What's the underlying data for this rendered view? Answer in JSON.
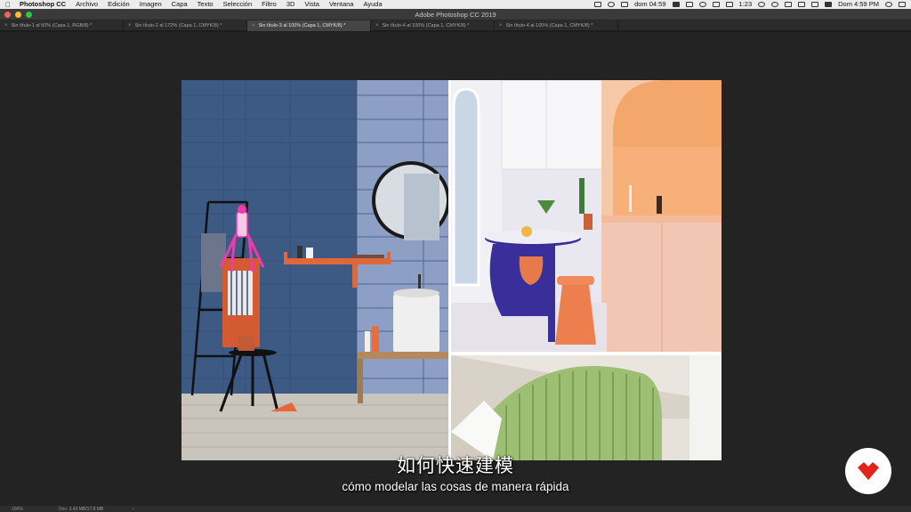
{
  "menubar": {
    "app_name": "Photoshop CC",
    "items": [
      "Archivo",
      "Edición",
      "Imagen",
      "Capa",
      "Texto",
      "Selección",
      "Filtro",
      "3D",
      "Vista",
      "Ventana",
      "Ayuda"
    ],
    "status_time_left": "dom 04:59",
    "battery": "1:23",
    "clock": "Dom 4:59 PM"
  },
  "window": {
    "title": "Adobe Photoshop CC 2019"
  },
  "tabs": [
    {
      "label": "Sin título-1 al 50% (Capa 1, RGB/8) *",
      "active": false
    },
    {
      "label": "Sin título-2 al 172% (Capa 1, CMYK/8) *",
      "active": false
    },
    {
      "label": "Sin título-3 al 100% (Capa 1, CMYK/8) *",
      "active": true
    },
    {
      "label": "Sin título-4 al 100% (Capa 1, CMYK/8) *",
      "active": false
    },
    {
      "label": "Sin título-4 al 100% (Capa 1, CMYK/8) *",
      "active": false
    }
  ],
  "subtitles": {
    "zh": "如何快速建模",
    "es": "cómo modelar las cosas de manera rápida"
  },
  "statusbar": {
    "zoom": "100%",
    "doc": "Doc: 3,43 MB/17,8 MB",
    "arrow": "›"
  },
  "colors": {
    "traffic_red": "#fc5f57",
    "traffic_yellow": "#fdbc2e",
    "traffic_green": "#2ac940",
    "logo_red": "#e2231a"
  }
}
